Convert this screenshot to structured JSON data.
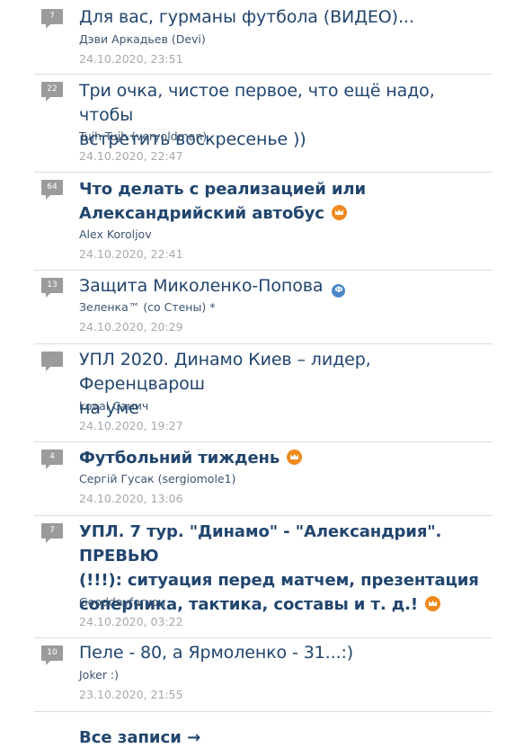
{
  "posts": [
    {
      "count": "7",
      "title": "Для вас, гурманы футбола (ВИДЕО)...",
      "author": "Дэви Аркадьев (Devi)",
      "date": "24.10.2020, 23:51"
    },
    {
      "count": "22",
      "title_l1": "Три очка, чистое первое, что ещё надо, чтобы",
      "title_l2": "встретить воскресенье ))",
      "author": "Tujh Tujh (veryoldman)",
      "date": "24.10.2020, 22:47"
    },
    {
      "count": "64",
      "title_l1": "Что делать с реализацией или",
      "title_l2": "Александрийский автобус",
      "author": "Alex Koroljov",
      "date": "24.10.2020, 22:41",
      "icon": "crown-icon"
    },
    {
      "count": "13",
      "title": "Защита Миколенко-Попова",
      "author": "Зеленка™ (со Стены) *",
      "date": "24.10.2020, 20:29",
      "icon": "verified-icon",
      "icon_text": "Ф"
    },
    {
      "count": "",
      "title_l1": "УПЛ 2020. Динамо Киев – лидер, Ференцварош",
      "title_l2": "на уме",
      "author": "koaal Санич",
      "date": "24.10.2020, 19:27"
    },
    {
      "count": "4",
      "title": "Футбольний тиждень",
      "author": "Сергій Гусак (sergiomole1)",
      "date": "24.10.2020, 13:06",
      "icon": "crown-icon"
    },
    {
      "count": "7",
      "title_l1": "УПЛ. 7 тур. \"Динамо\" - \"Александрия\". ПРЕВЬЮ",
      "title_l2": "(!!!): ситуация перед матчем, презентация",
      "title_l3": "соперника, тактика, составы и т. д.!",
      "author": "Gooddayforyou",
      "date": "24.10.2020, 03:22",
      "icon": "crown-icon"
    },
    {
      "count": "10",
      "title": "Пеле - 80, а Ярмоленко - 31...:)",
      "author": "Joker :)",
      "date": "23.10.2020, 21:55"
    }
  ],
  "all_posts_label": "Все записи →",
  "colors": {
    "title": "#21456e",
    "badge": "#9b9b9b",
    "crown": "#f08a1c",
    "verified": "#4a88c8"
  }
}
